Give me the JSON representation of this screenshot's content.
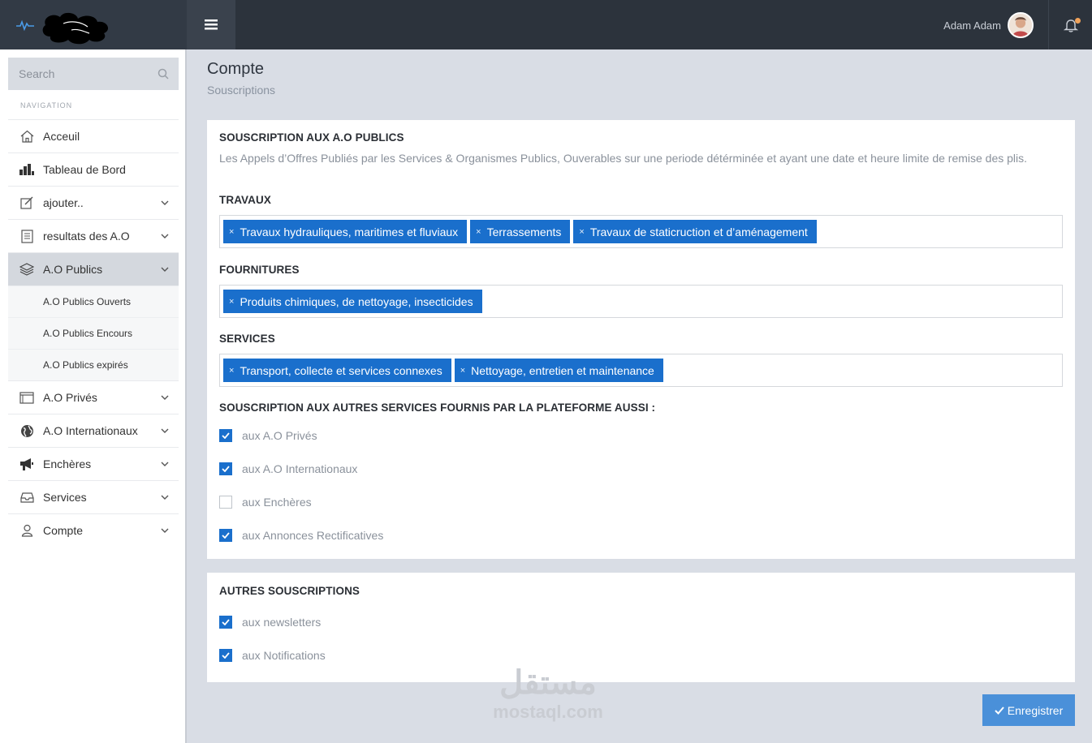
{
  "header": {
    "user_name": "Adam Adam"
  },
  "sidebar": {
    "search_placeholder": "Search",
    "nav_title": "NAVIGATION",
    "items": [
      {
        "label": "Acceuil",
        "icon": "home-icon"
      },
      {
        "label": "Tableau de Bord",
        "icon": "bar-chart-icon"
      },
      {
        "label": "ajouter..",
        "icon": "edit-icon"
      },
      {
        "label": "resultats des A.O",
        "icon": "document-icon"
      },
      {
        "label": "A.O Publics",
        "icon": "layers-icon"
      },
      {
        "label": "A.O Privés",
        "icon": "window-icon"
      },
      {
        "label": "A.O Internationaux",
        "icon": "globe-icon"
      },
      {
        "label": "Enchères",
        "icon": "megaphone-icon"
      },
      {
        "label": "Services",
        "icon": "inbox-icon"
      },
      {
        "label": "Compte",
        "icon": "user-icon"
      }
    ],
    "sub_items": [
      {
        "label": "A.O Publics Ouverts"
      },
      {
        "label": "A.O Publics Encours"
      },
      {
        "label": "A.O Publics expirés"
      }
    ]
  },
  "page": {
    "title": "Compte",
    "subtitle": "Souscriptions"
  },
  "panel1": {
    "heading": "SOUSCRIPTION AUX A.O PUBLICS",
    "description": "Les Appels d’Offres Publiés par les Services & Organismes Publics, Ouverables sur une periode détérminée et ayant une date et heure limite de remise des plis.",
    "travaux": {
      "label": "TRAVAUX",
      "tags": [
        "Travaux hydrauliques, maritimes et fluviaux",
        "Terrassements",
        "Travaux de staticruction et d’aménagement"
      ]
    },
    "fournitures": {
      "label": "FOURNITURES",
      "tags": [
        "Produits chimiques, de nettoyage, insecticides"
      ]
    },
    "services": {
      "label": "SERVICES",
      "tags": [
        "Transport, collecte et services connexes",
        "Nettoyage, entretien et maintenance"
      ]
    },
    "others_heading": "SOUSCRIPTION AUX AUTRES SERVICES FOURNIS PAR LA PLATEFORME AUSSI :",
    "checkboxes": [
      {
        "label": "aux A.O Privés",
        "checked": true
      },
      {
        "label": "aux A.O Internationaux",
        "checked": true
      },
      {
        "label": "aux Enchères",
        "checked": false
      },
      {
        "label": "aux Annonces Rectificatives",
        "checked": true
      }
    ]
  },
  "panel2": {
    "heading": "AUTRES SOUSCRIPTIONS",
    "checkboxes": [
      {
        "label": "aux newsletters",
        "checked": true
      },
      {
        "label": "aux Notifications",
        "checked": true
      }
    ]
  },
  "save_label": "Enregistrer",
  "tag_remove_symbol": "×",
  "watermark": {
    "arabic": "مستقل",
    "latin": "mostaql.com"
  },
  "colors": {
    "topbar": "#2c333c",
    "accent": "#1a6fcc",
    "save_button": "#4a90d9",
    "background": "#d9dde5"
  }
}
